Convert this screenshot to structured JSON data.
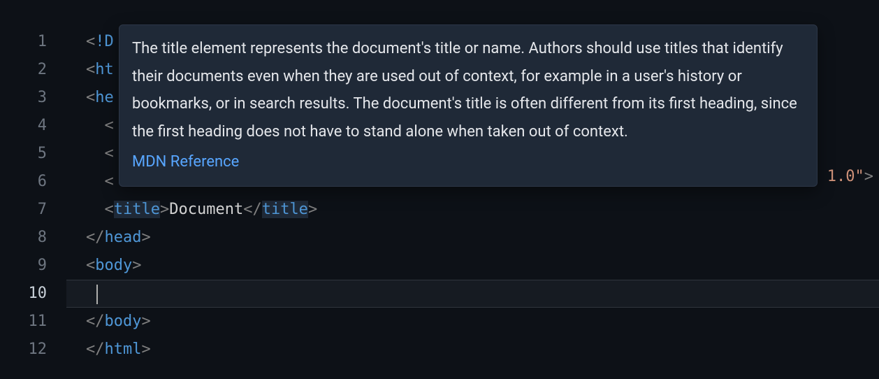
{
  "gutter": [
    "1",
    "2",
    "3",
    "4",
    "5",
    "6",
    "7",
    "8",
    "9",
    "10",
    "11",
    "12"
  ],
  "activeLine": 10,
  "code": {
    "l1_doctype": "D",
    "l2_tag": "ht",
    "l3_tag": "he",
    "l7_tag_open": "title",
    "l7_text": "Document",
    "l7_tag_close": "title",
    "l8_tag": "head",
    "l9_tag": "body",
    "l11_tag": "body",
    "l12_tag": "html"
  },
  "overflow_line6": "1.0\"",
  "tooltip": {
    "description": "The title element represents the document's title or name. Authors should use titles that identify their documents even when they are used out of context, for example in a user's history or bookmarks, or in search results. The document's title is often different from its first heading, since the first heading does not have to stand alone when taken out of context.",
    "link_label": "MDN Reference"
  }
}
